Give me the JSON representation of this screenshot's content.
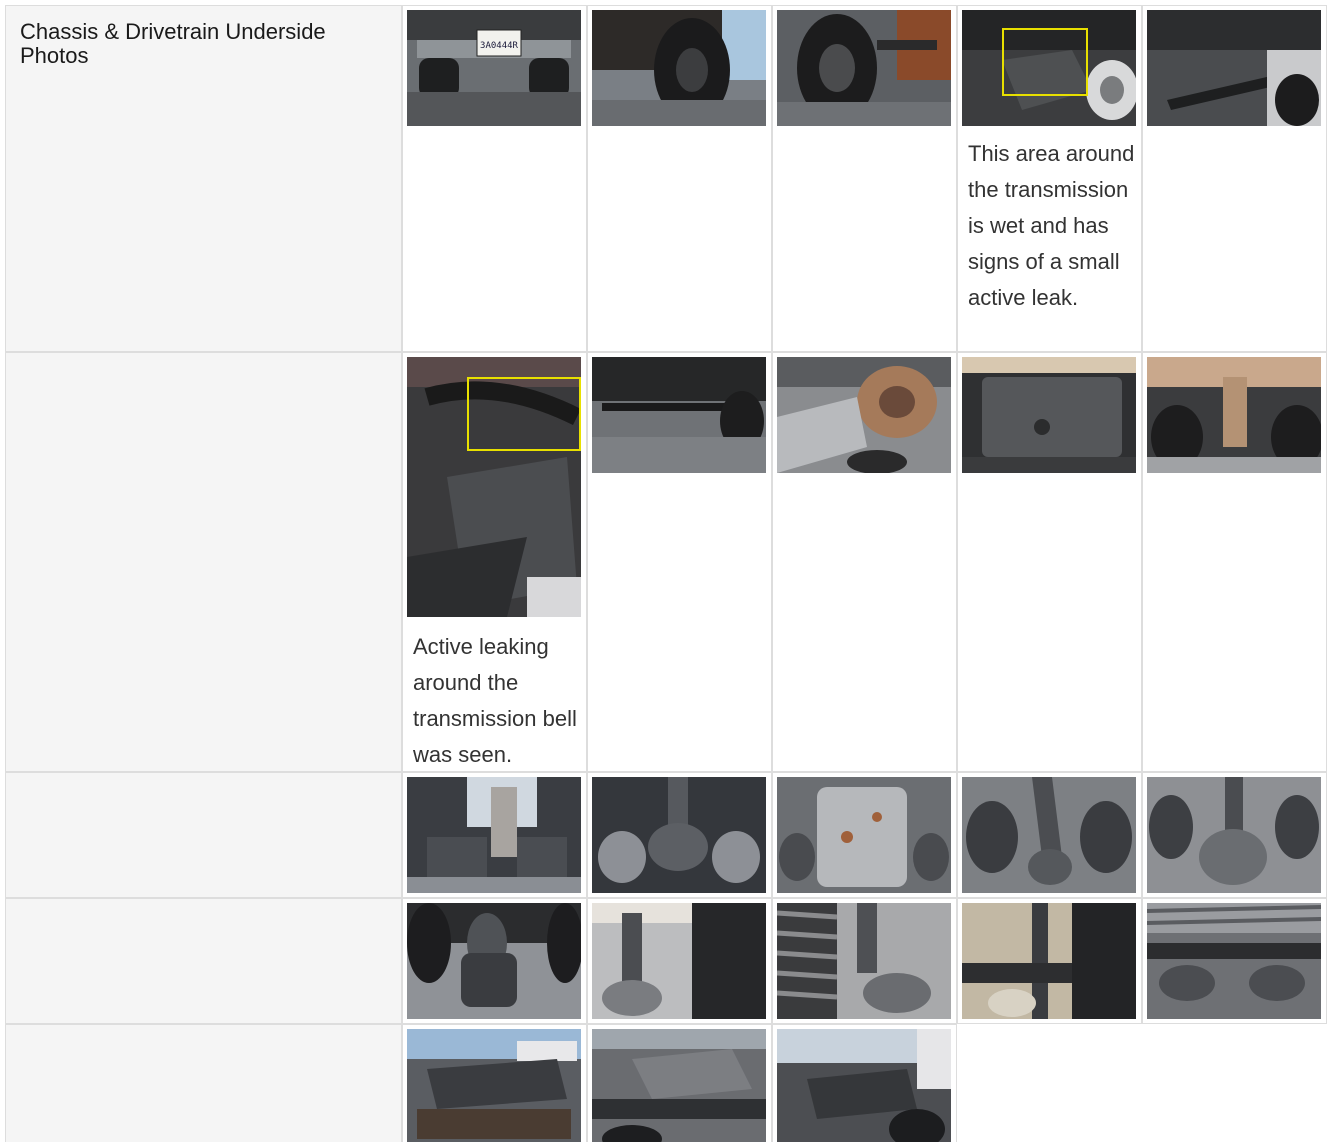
{
  "section": {
    "title": "Chassis & Drivetrain Underside Photos"
  },
  "photos": [
    {
      "subject": "rear-bumper-license-plate",
      "plate_text": "3A0444R"
    },
    {
      "subject": "front-wheel-underside"
    },
    {
      "subject": "front-axle-wheel"
    },
    {
      "subject": "transmission-area-highlighted"
    },
    {
      "subject": "suspension-arm-underside"
    },
    {
      "subject": "transmission-bell-highlighted"
    },
    {
      "subject": "front-crossmember"
    },
    {
      "subject": "transmission-housing-side"
    },
    {
      "subject": "oil-pan-underside"
    },
    {
      "subject": "driveshaft-crossmember"
    },
    {
      "subject": "driveshaft-rear-axle"
    },
    {
      "subject": "rear-axle-differential"
    },
    {
      "subject": "differential-housing"
    },
    {
      "subject": "driveshaft-airbags"
    },
    {
      "subject": "rear-differential-airbags"
    },
    {
      "subject": "airbag-suspension-wheel"
    },
    {
      "subject": "rear-wheel-frame"
    },
    {
      "subject": "tire-tread-airbag"
    },
    {
      "subject": "frame-rail-wheel"
    },
    {
      "subject": "tire-tread-frame"
    },
    {
      "subject": "fifth-wheel-hitch-1"
    },
    {
      "subject": "fifth-wheel-hitch-2"
    },
    {
      "subject": "fifth-wheel-hitch-3"
    }
  ],
  "captions": {
    "transmission_leak": "This area around the transmission is wet and has signs of a small active leak.",
    "bell_leak": "Active leaking around the transmission bell was seen."
  },
  "colors": {
    "highlight": "#e8e000",
    "label_bg": "#f5f5f5",
    "border": "#dddddd"
  }
}
